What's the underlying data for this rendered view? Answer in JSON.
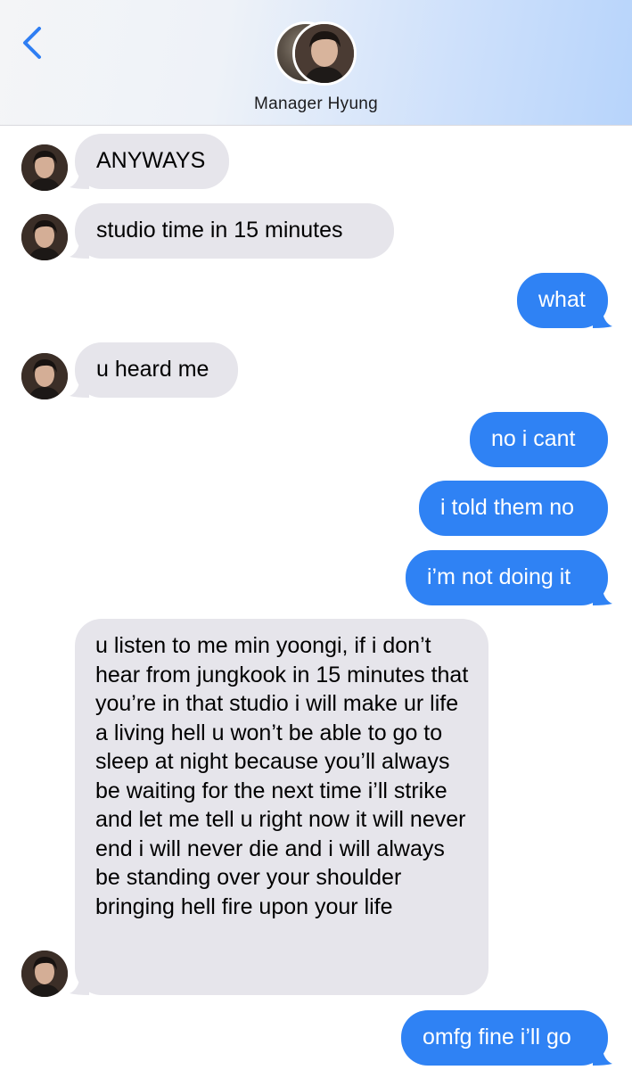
{
  "header": {
    "contact_name": "Manager Hyung",
    "back_icon": "chevron-left-icon",
    "accent_color": "#2f7ef3"
  },
  "messages": [
    {
      "direction": "incoming",
      "text": "ANYWAYS"
    },
    {
      "direction": "incoming",
      "text": "studio time in 15 minutes"
    },
    {
      "direction": "outgoing",
      "text": "what"
    },
    {
      "direction": "incoming",
      "text": "u heard me"
    },
    {
      "direction": "outgoing",
      "text": "no i cant"
    },
    {
      "direction": "outgoing",
      "text": "i told them no"
    },
    {
      "direction": "outgoing",
      "text": "i’m not doing it"
    },
    {
      "direction": "incoming",
      "text": "u listen to me min yoongi, if i don’t hear from jungkook in 15 minutes that you’re in that studio i will make ur life a living hell u won’t be able to go to sleep at night because you’ll always be waiting for the next time i’ll strike and let me tell u right now it will never end i will never die and i will always be standing over your shoulder bringing hell fire upon your life"
    },
    {
      "direction": "outgoing",
      "text": "omfg fine i’ll go"
    }
  ],
  "colors": {
    "incoming_bubble": "#e6e5eb",
    "outgoing_bubble": "#2f82f4",
    "outgoing_text": "#ffffff"
  }
}
